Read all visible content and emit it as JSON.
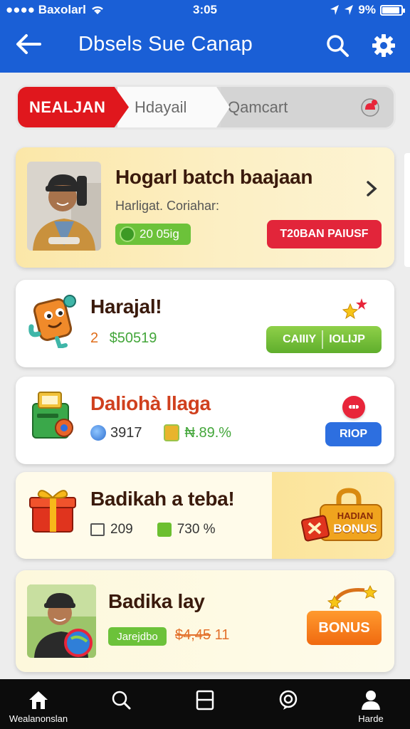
{
  "status_bar": {
    "carrier": "●●●● Baxolarl",
    "time": "3:05",
    "battery": "9%"
  },
  "header": {
    "title": "Dbsels Sue Canap"
  },
  "tabs": [
    {
      "label": "NEALJAN",
      "active": true
    },
    {
      "label": "Hdayail",
      "active": false
    },
    {
      "label": "Qamcart",
      "active": false
    }
  ],
  "cards": [
    {
      "title": "Hogarl batch baajaan",
      "subtitle": "Harligat. Coriahar:",
      "pill": "20 05ig",
      "button": "T20BAN PAIUSF"
    },
    {
      "title": "Harajal!",
      "count": "2",
      "value": "$50519",
      "button_left": "CAIIIY",
      "button_right": "IOLIJP"
    },
    {
      "title": "Daliohà llaga",
      "stat_a": "3917",
      "stat_b": "₦.89.%",
      "button": "RIOP"
    },
    {
      "title": "Badikah a teba!",
      "stat_a": "209",
      "stat_b": "730 %",
      "badge_line1": "HADIAN",
      "badge_line2": "BONUS"
    },
    {
      "title": "Badika lay",
      "pill": "Jarejdbo",
      "price_old": "$4,45",
      "price_new": "11",
      "button": "BONUS"
    }
  ],
  "bottom_nav": [
    {
      "label": "Wealanonslan",
      "icon": "home-icon",
      "active": true
    },
    {
      "label": "",
      "icon": "search-icon"
    },
    {
      "label": "",
      "icon": "tablet-icon"
    },
    {
      "label": "",
      "icon": "chat-bubble-icon"
    },
    {
      "label": "Harde",
      "icon": "profile-icon"
    }
  ],
  "colors": {
    "header_blue": "#1a5fd6",
    "active_tab_red": "#e0171d",
    "button_red": "#e2253a",
    "button_green": "#6cc23a",
    "button_blue": "#2d6fe0",
    "button_orange": "#f06a10"
  }
}
